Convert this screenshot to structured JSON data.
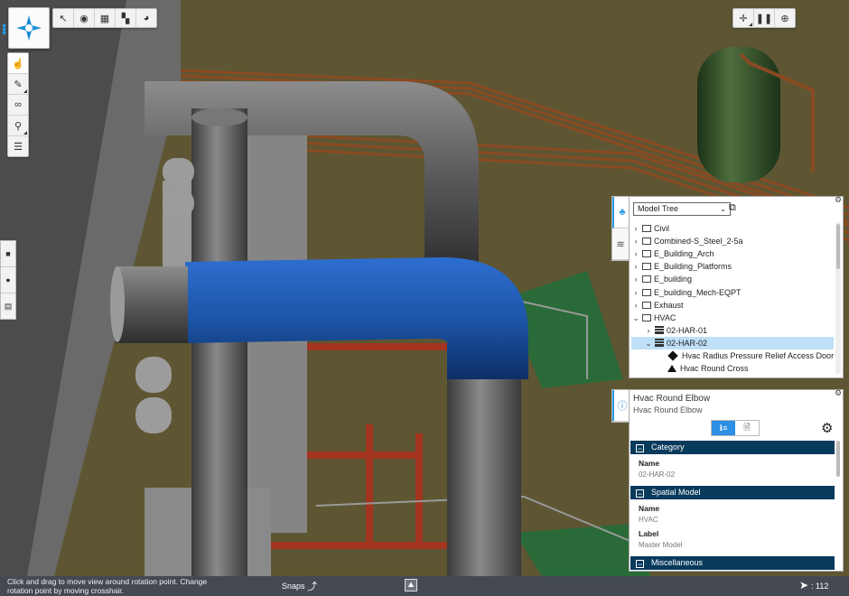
{
  "viewport": {
    "background_color": "#5e5633",
    "highlight_color": "#1c56a8"
  },
  "top_toolbar": {
    "buttons": [
      {
        "icon": "select-cursor-icon"
      },
      {
        "icon": "visibility-eye-icon"
      },
      {
        "icon": "grid-icon"
      },
      {
        "icon": "section-icon"
      },
      {
        "icon": "palette-icon"
      }
    ]
  },
  "right_toolbar": {
    "buttons": [
      {
        "icon": "crosshair-icon"
      },
      {
        "icon": "walk-footprints-icon"
      },
      {
        "icon": "view-cube-icon"
      }
    ]
  },
  "left_toolbar": {
    "buttons": [
      {
        "icon": "pointer-icon"
      },
      {
        "icon": "measure-ruler-icon"
      },
      {
        "icon": "binoculars-icon"
      },
      {
        "icon": "markup-icon"
      },
      {
        "icon": "layers-stack-icon"
      }
    ]
  },
  "left_edge_toolbar": {
    "buttons": [
      {
        "icon": "camera-icon"
      },
      {
        "icon": "drone-icon"
      },
      {
        "icon": "clipboard-icon"
      }
    ]
  },
  "model_tree": {
    "dropdown_value": "Model Tree",
    "items": [
      {
        "label": "Civil",
        "caret": "›",
        "icon": "model"
      },
      {
        "label": "Combined-S_Steel_2-5a",
        "caret": "›",
        "icon": "model"
      },
      {
        "label": "E_Building_Arch",
        "caret": "›",
        "icon": "model"
      },
      {
        "label": "E_Building_Platforms",
        "caret": "›",
        "icon": "model"
      },
      {
        "label": "E_building",
        "caret": "›",
        "icon": "model"
      },
      {
        "label": "E_building_Mech-EQPT",
        "caret": "›",
        "icon": "model"
      },
      {
        "label": "Exhaust",
        "caret": "›",
        "icon": "model"
      },
      {
        "label": "HVAC",
        "caret": "⌄",
        "icon": "model"
      },
      {
        "label": "02-HAR-01",
        "caret": "›",
        "icon": "layer",
        "indent": 1
      },
      {
        "label": "02-HAR-02",
        "caret": "⌄",
        "icon": "layer",
        "indent": 1,
        "selected": true
      },
      {
        "label": "Hvac Radius Pressure Relief Access Door",
        "caret": "",
        "icon": "diamond",
        "indent": 2
      },
      {
        "label": "Hvac Round Cross",
        "caret": "",
        "icon": "triangle",
        "indent": 2
      }
    ]
  },
  "properties": {
    "title": "Hvac Round Elbow",
    "subtitle": "Hvac Round Elbow",
    "tab_info_label": "ℹ ≡",
    "sections": [
      {
        "header": "Category",
        "rows": [
          {
            "name": "Name",
            "value": "02-HAR-02"
          }
        ]
      },
      {
        "header": "Spatial Model",
        "rows": [
          {
            "name": "Name",
            "value": "HVAC"
          },
          {
            "name": "Label",
            "value": "Master Model"
          }
        ]
      },
      {
        "header": "Miscellaneous",
        "rows": []
      }
    ]
  },
  "status_bar": {
    "hint": "Click and drag to move view around rotation point. Change rotation point by moving crosshair.",
    "snaps_label": "Snaps",
    "count": ": 112"
  }
}
